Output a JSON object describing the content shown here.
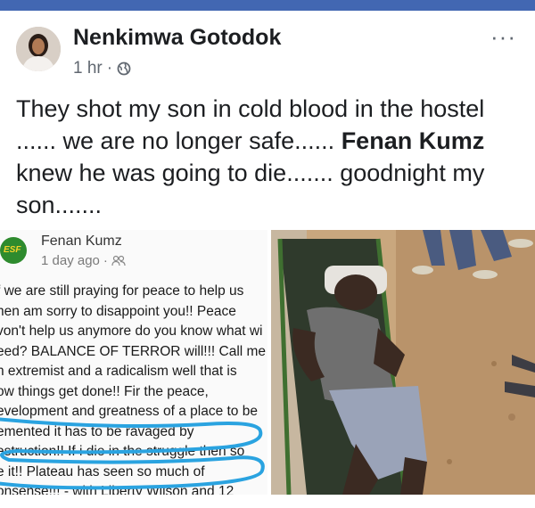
{
  "post": {
    "author": "Nenkimwa Gotodok",
    "time": "1 hr",
    "separator": "·",
    "privacy_icon": "globe-icon",
    "more_label": "···",
    "text_part1": "They shot my son in cold blood in the hostel  ...... we are no longer safe...... ",
    "text_bold1": "Fenan Kumz",
    "text_part2": " knew he was going to die....... goodnight my son......."
  },
  "screenshot": {
    "name": "Fenan Kumz",
    "time": "1 day ago",
    "separator": "·",
    "audience_icon": "friends-icon",
    "logo_text": "ESF",
    "lines": [
      "f we are still praying for peace to help us",
      "hen am sorry to disappoint you!! Peace",
      "von't help us anymore do you know what wi",
      "eed? BALANCE OF TERROR will!!! Call me",
      "n extremist and a radicalism well that is",
      "ow things get done!! Fir the peace,",
      "evelopment and greatness of a place to be",
      "emented it has to be ravaged by",
      "estruction!! If i die in the struggle then so",
      "e it!! Plateau has seen so much of",
      "onsense!!! - with Liberty Wilson and 12"
    ],
    "highlight_color": "#2aa3e0"
  },
  "colors": {
    "header_bar": "#4267b2",
    "text": "#1c1e21",
    "meta": "#606770"
  }
}
